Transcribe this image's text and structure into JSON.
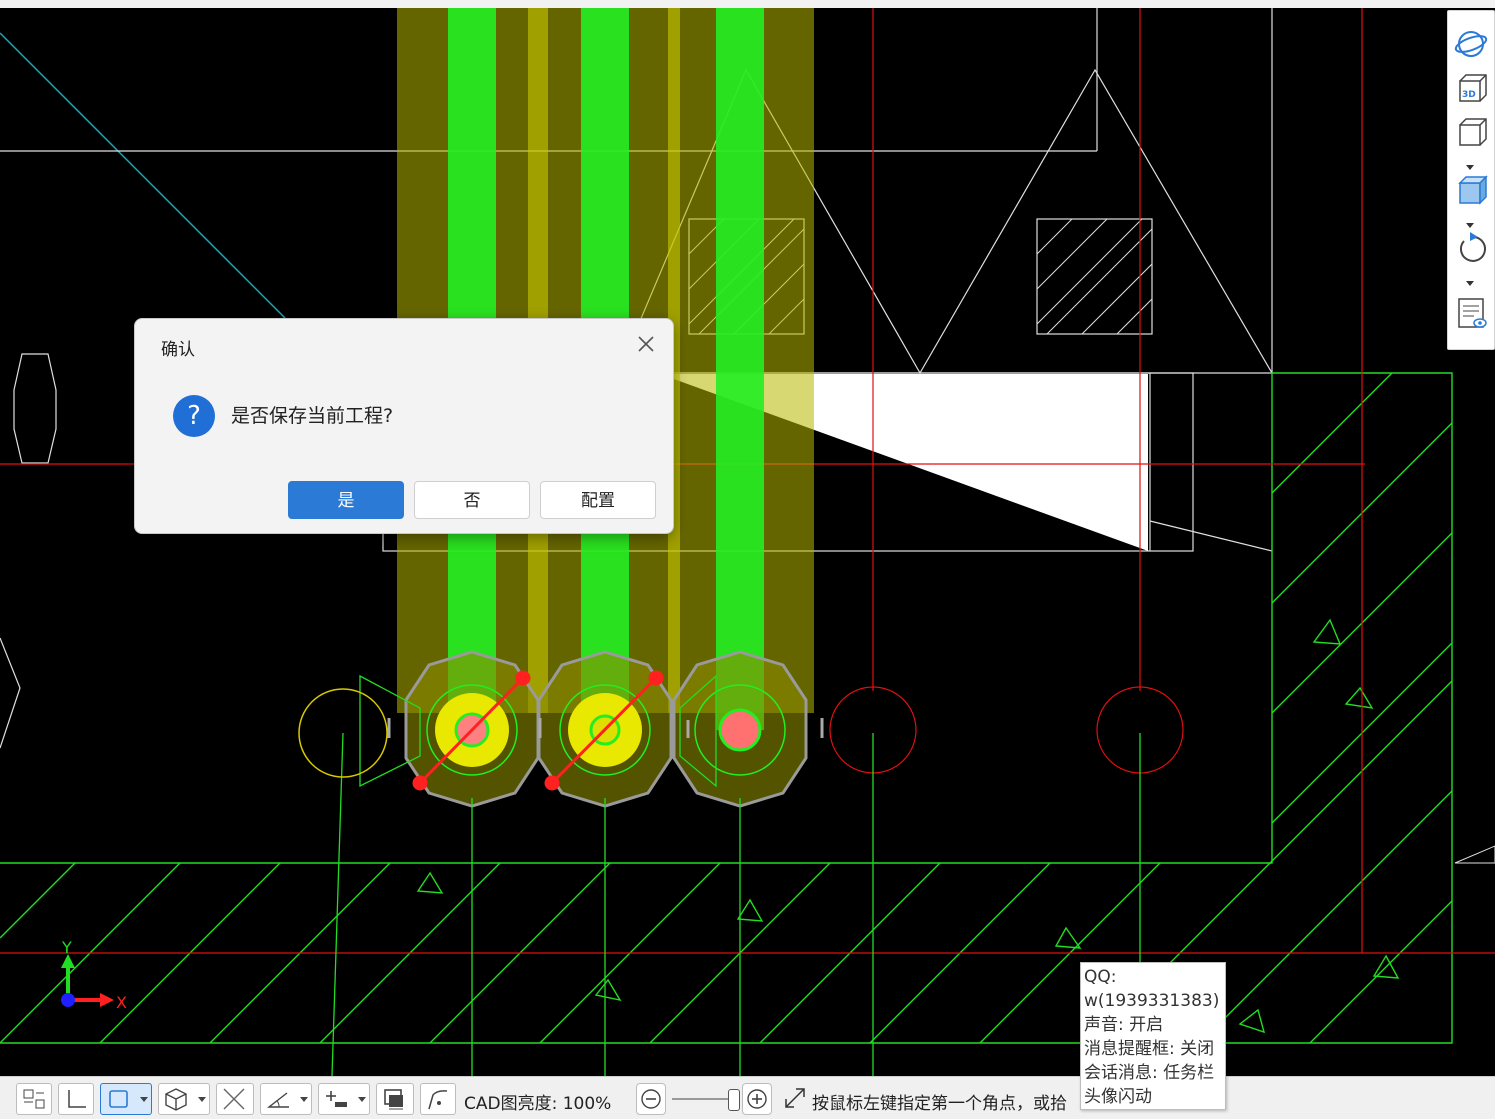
{
  "dialog": {
    "title": "确认",
    "message": "是否保存当前工程?",
    "icon": "question-icon",
    "icon_glyph": "?",
    "buttons": {
      "yes": "是",
      "no": "否",
      "config": "配置"
    },
    "accent_color": "#2a7ad6"
  },
  "axis": {
    "x_label": "X",
    "y_label": "Y"
  },
  "view_toolbar": {
    "items": [
      "orbit-icon",
      "3d-view-icon",
      "view-box-icon",
      "shaded-box-icon",
      "rotate-icon",
      "properties-view-icon"
    ],
    "badge_3d": "3D"
  },
  "statusbar": {
    "tools": [
      "grid-snap-icon",
      "ortho-icon",
      "selection-box-icon",
      "3d-cube-icon",
      "cross-icon",
      "angle-icon",
      "insert-icon",
      "display-icon",
      "polyline-icon"
    ],
    "brightness_label": "CAD图亮度:",
    "brightness_value": "100%",
    "brightness_level": 1.0,
    "prompt": "按鼠标左键指定第一个角点，或拾"
  },
  "tooltip": {
    "lines": [
      "QQ:",
      "w(1939331383)",
      "声音: 开启",
      "消息提醒框: 关闭",
      "会话消息: 任务栏",
      "头像闪动"
    ]
  },
  "colors": {
    "background": "#000000",
    "grid_green": "#22dd22",
    "bar_green": "#22ee22",
    "highlight_yellow": "#b8b800",
    "red_line": "#e01010",
    "white_line": "#e8e8e8"
  }
}
